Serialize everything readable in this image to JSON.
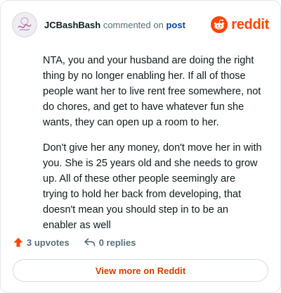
{
  "header": {
    "username": "JCBashBash",
    "action_text": "commented on",
    "post_link": "post",
    "brand": "reddit"
  },
  "comment": {
    "paragraphs": [
      "NTA, you and your husband are doing the right thing by no longer enabling her. If all of those people want her to live rent free somewhere, not do chores, and get to have whatever fun she wants, they can open up a room to her.",
      "Don't give her any money, don't move her in with you. She is 25 years old and she needs to grow up. All of these other people seemingly are trying to hold her back from developing, that doesn't mean you should step in to be an enabler as well"
    ]
  },
  "actions": {
    "upvotes": "3 upvotes",
    "replies": "0 replies"
  },
  "footer": {
    "view_more": "View more on Reddit"
  },
  "colors": {
    "brand": "#ff4500",
    "upvote": "#ff4500",
    "link": "#0a449b",
    "view_more_text": "#d93a00"
  },
  "icons": {
    "avatar": "user-avatar",
    "brand": "reddit-alien-icon",
    "upvote": "upvote-arrow-icon",
    "reply": "reply-arrow-icon"
  }
}
